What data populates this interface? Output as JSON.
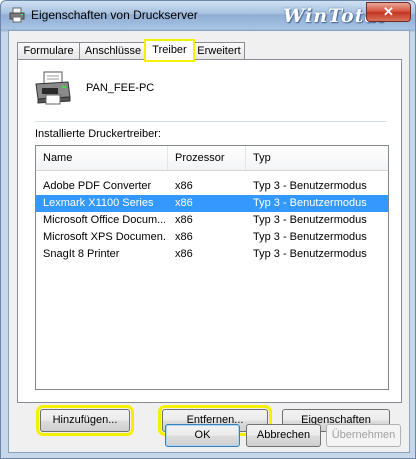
{
  "window": {
    "title": "Eigenschaften von Druckserver",
    "watermark": "WinTotal",
    "close_glyph": "✕"
  },
  "tabs": [
    {
      "label": "Formulare"
    },
    {
      "label": "Anschlüsse"
    },
    {
      "label": "Treiber",
      "active": true
    },
    {
      "label": "Erweitert"
    }
  ],
  "server": {
    "name": "PAN_FEE-PC",
    "icon": "printer-icon"
  },
  "drivers": {
    "label": "Installierte Druckertreiber:",
    "columns": [
      "Name",
      "Prozessor",
      "Typ"
    ],
    "rows": [
      {
        "name": "Adobe PDF Converter",
        "processor": "x86",
        "type": "Typ 3 - Benutzermodus",
        "selected": false
      },
      {
        "name": "Lexmark X1100 Series",
        "processor": "x86",
        "type": "Typ 3 - Benutzermodus",
        "selected": true
      },
      {
        "name": "Microsoft Office Docum...",
        "processor": "x86",
        "type": "Typ 3 - Benutzermodus",
        "selected": false
      },
      {
        "name": "Microsoft XPS Documen...",
        "processor": "x86",
        "type": "Typ 3 - Benutzermodus",
        "selected": false
      },
      {
        "name": "SnagIt 8 Printer",
        "processor": "x86",
        "type": "Typ 3 - Benutzermodus",
        "selected": false
      }
    ]
  },
  "panel_buttons": {
    "add": "Hinzufügen...",
    "remove": "Entfernen...",
    "properties": "Eigenschaften"
  },
  "dialog_buttons": {
    "ok": "OK",
    "cancel": "Abbrechen",
    "apply": "Übernehmen"
  },
  "colors": {
    "highlight": "#f3f000",
    "selection": "#3399ff"
  }
}
